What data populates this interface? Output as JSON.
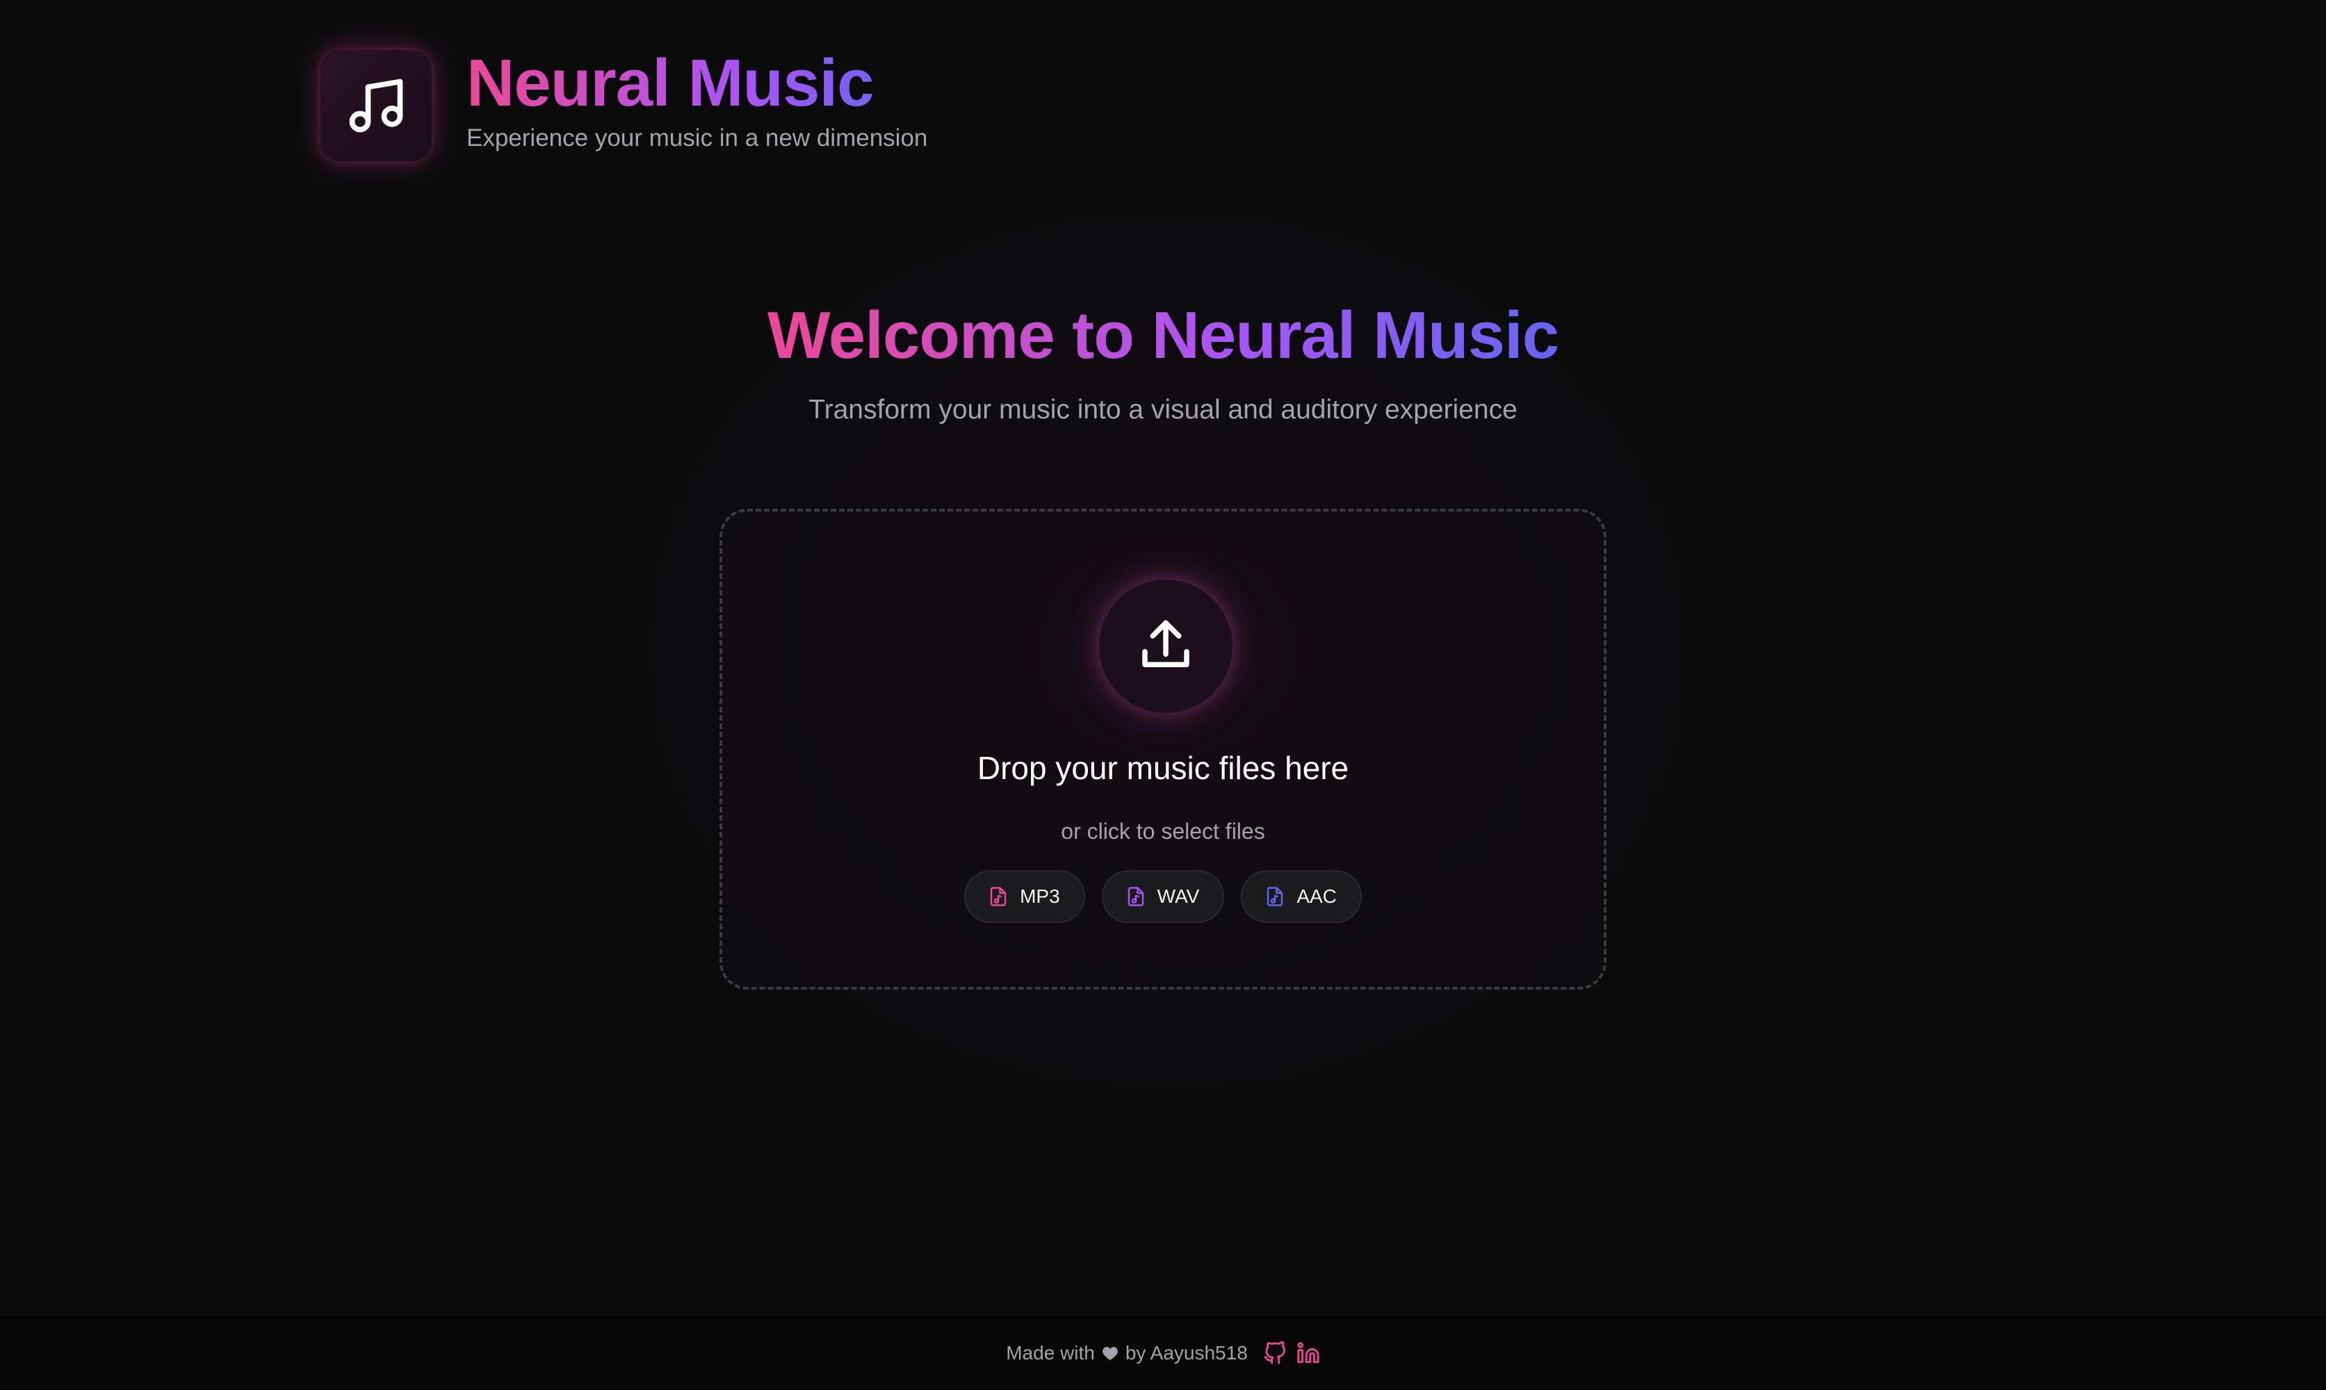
{
  "header": {
    "app_title": "Neural Music",
    "app_subtitle": "Experience your music in a new dimension",
    "logo_icon": "music-note-icon"
  },
  "hero": {
    "title": "Welcome to Neural Music",
    "subtitle": "Transform your music into a visual and auditory experience"
  },
  "dropzone": {
    "icon": "upload-icon",
    "title": "Drop your music files here",
    "hint": "or click to select files",
    "formats": [
      {
        "label": "MP3",
        "color": "#ec4899",
        "icon": "music-file-icon"
      },
      {
        "label": "WAV",
        "color": "#a855f7",
        "icon": "music-file-icon"
      },
      {
        "label": "AAC",
        "color": "#6366f1",
        "icon": "music-file-icon"
      }
    ]
  },
  "footer": {
    "made_with": "Made with",
    "by_text": "by Aayush518",
    "heart_icon": "heart-icon",
    "links": [
      {
        "icon": "github-icon"
      },
      {
        "icon": "linkedin-icon"
      }
    ]
  },
  "colors": {
    "background": "#0b0b0c",
    "accent_pink": "#ec4899",
    "accent_purple": "#a855f7",
    "accent_indigo": "#6366f1",
    "muted_text": "#a3a3aa"
  }
}
